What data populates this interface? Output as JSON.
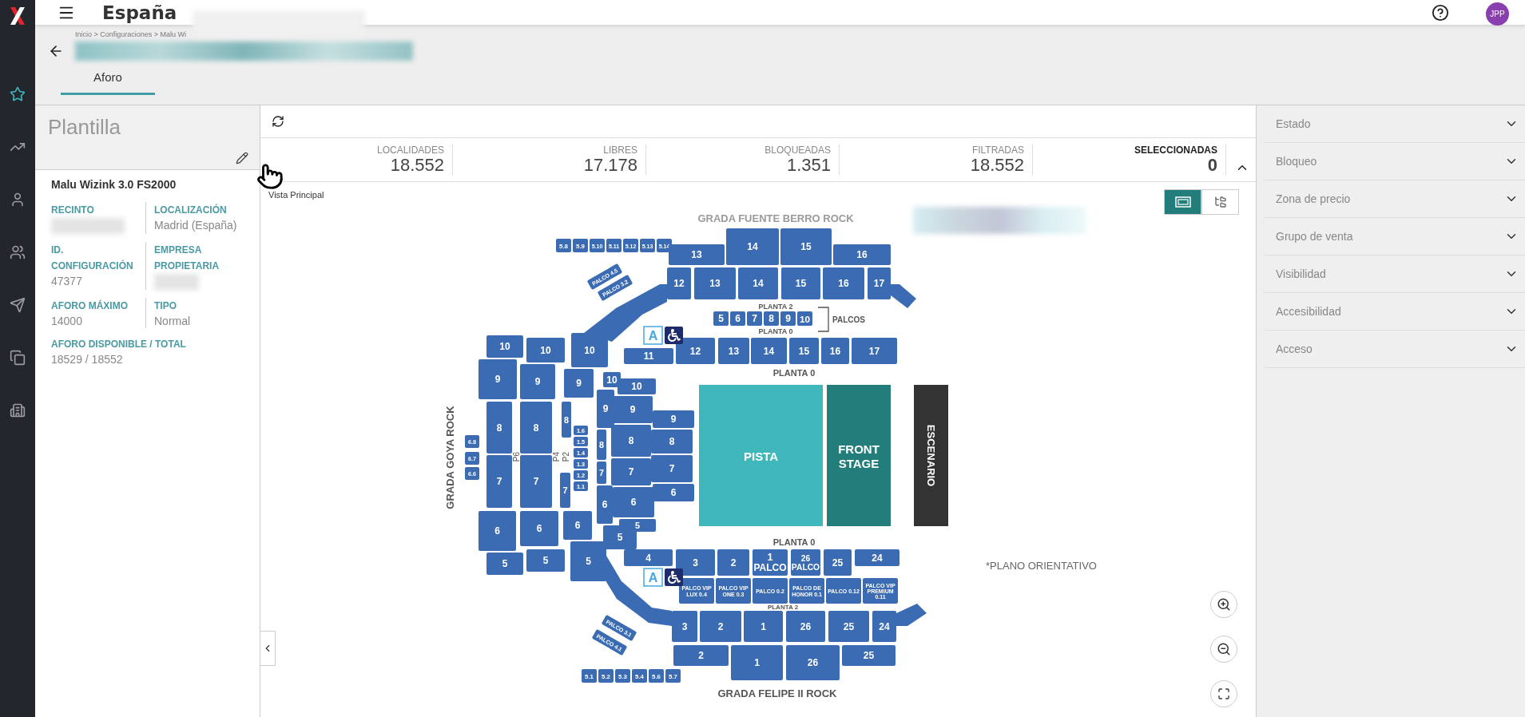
{
  "nav": [
    {
      "kind": "star",
      "selected": true
    },
    {
      "kind": "trend",
      "selected": false
    },
    {
      "kind": "user",
      "selected": false
    },
    {
      "kind": "group",
      "selected": false
    },
    {
      "kind": "send",
      "selected": false
    },
    {
      "kind": "copy",
      "selected": false
    },
    {
      "kind": "building",
      "selected": false
    }
  ],
  "topbar": {
    "title": "España",
    "avatar": "JPP"
  },
  "breadcrumb": "Inicio > Configuraciones > Malu Wi",
  "tabs": [
    {
      "label": "Aforo",
      "selected": true
    }
  ],
  "template": {
    "title": "Plantilla",
    "name": "Malu Wizink 3.0 FS2000",
    "fields": [
      {
        "label": "RECINTO",
        "redacted": true
      },
      {
        "label": "LOCALIZACIÓN",
        "value": "Madrid (España)",
        "redacted": false
      },
      {
        "label": "ID.\nCONFIGURACIÓN",
        "value": "47377",
        "redacted": false
      },
      {
        "label": "EMPRESA\nPROPIETARIA",
        "redacted": true
      },
      {
        "label": "AFORO MÁXIMO",
        "value": "14000",
        "redacted": false
      },
      {
        "label": "TIPO",
        "value": "Normal",
        "redacted": false
      },
      {
        "label": "AFORO DISPONIBLE / TOTAL",
        "value": "18529 / 18552",
        "redacted": false
      }
    ]
  },
  "stats": [
    {
      "label": "LOCALIDADES",
      "value": "18.552",
      "emphasis": false
    },
    {
      "label": "LIBRES",
      "value": "17.178",
      "emphasis": false
    },
    {
      "label": "BLOQUEADAS",
      "value": "1.351",
      "emphasis": false
    },
    {
      "label": "FILTRADAS",
      "value": "18.552",
      "emphasis": false
    },
    {
      "label": "SELECCIONADAS",
      "value": "0",
      "emphasis": true
    }
  ],
  "map": {
    "title": "Vista Principal",
    "views": [
      {
        "kind": "map",
        "selected": true
      },
      {
        "kind": "tree",
        "selected": false
      }
    ],
    "stands": [
      "GRADA FUENTE BERRO ROCK",
      "GRADA GOYA ROCK",
      "GRADA FELIPE II ROCK"
    ],
    "floor_labels": [
      "PLANTA 2",
      "PLANTA 0",
      "PLANTA 0",
      "PLANTA 0",
      "PLANTA 2"
    ],
    "palcos_label": "PALCOS",
    "note": "*PLANO ORIENTATIVO",
    "aisle_labels": [
      "P6",
      "P4",
      "P2"
    ],
    "badges": [
      "A",
      "A"
    ],
    "areas": [
      {
        "label": "PISTA",
        "kind": "pista"
      },
      {
        "label": "FRONT\nSTAGE",
        "kind": "front"
      },
      {
        "label": "ESCENARIO",
        "kind": "stage"
      }
    ],
    "sections": [
      [
        "5.8",
        "5.9",
        "5.10",
        "5.11",
        "5.12",
        "5.13",
        "5.14"
      ],
      [
        "PALCO 4.5",
        "PALCO 3.2"
      ],
      [
        "13",
        "14",
        "15",
        "16"
      ],
      [
        "12",
        "13",
        "14",
        "15",
        "16",
        "17"
      ],
      [
        "5",
        "6",
        "7",
        "8",
        "9",
        "10"
      ],
      [
        "11",
        "12",
        "13",
        "14",
        "15",
        "16",
        "17"
      ],
      [
        "6.8",
        "6.7",
        "6.6"
      ],
      [
        "10",
        "9",
        "8",
        "7",
        "6",
        "5"
      ],
      [
        "10",
        "9",
        "8",
        "7",
        "6",
        "5"
      ],
      [
        "10",
        "9",
        "8",
        "7",
        "6",
        "5"
      ],
      [
        "1.6",
        "1.5",
        "1.4",
        "1.3",
        "1.2",
        "1.1"
      ],
      [
        "10",
        "9",
        "8",
        "7",
        "6",
        "5"
      ],
      [
        "10",
        "9",
        "8",
        "7",
        "6",
        "5"
      ],
      [
        "9",
        "8",
        "7",
        "6"
      ],
      [
        "4",
        "3",
        "2",
        "1\nPALCO",
        "26\nPALCO",
        "25",
        "24"
      ],
      [
        "PALCO VIP\nLUX 0.4",
        "PALCO VIP\nONE 0.3",
        "PALCO 0.2",
        "PALCO DE\nHONOR 0.1",
        "PALCO 0.12",
        "PALCO VIP\nPREMIUM\n0.11"
      ],
      [
        "3",
        "2",
        "1",
        "26",
        "25",
        "24"
      ],
      [
        "2",
        "1",
        "26",
        "25"
      ],
      [
        "PALCO 3.1",
        "PALCO 4.1"
      ],
      [
        "5.1",
        "5.2",
        "5.3",
        "5.4",
        "5.6",
        "5.7"
      ]
    ]
  },
  "filters": [
    "Estado",
    "Bloqueo",
    "Zona de precio",
    "Grupo de venta",
    "Visibilidad",
    "Accesibilidad",
    "Acceso"
  ]
}
